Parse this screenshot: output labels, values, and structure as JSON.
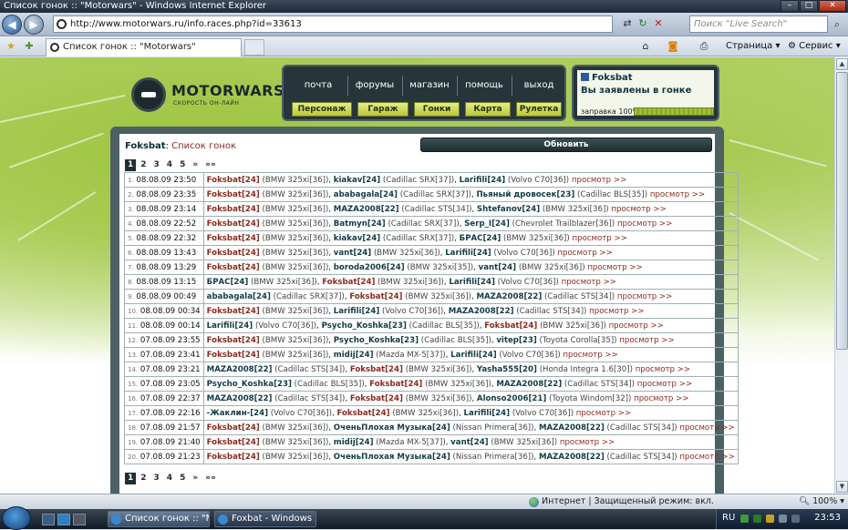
{
  "window": {
    "title": "Список гонок :: \"Motorwars\" - Windows Internet Explorer"
  },
  "browser": {
    "url": "http://www.motorwars.ru/info.races.php?id=33613",
    "search_placeholder": "Поиск \"Live Search\"",
    "tab_title": "Список гонок :: \"Motorwars\"",
    "page_menu": "Страница",
    "tools_menu": "Сервис"
  },
  "site": {
    "logo_text": "MOTORWARS.RU",
    "logo_sub": "СКОРОСТЬ ОН-ЛАЙН",
    "menu_top": [
      "почта",
      "форумы",
      "магазин",
      "помощь",
      "выход"
    ],
    "menu_bottom": [
      "Персонаж",
      "Гараж",
      "Гонки",
      "Карта",
      "Рулетка"
    ],
    "user": {
      "name": "Foksbat",
      "status": "Вы заявлены в гонке",
      "fuel_label": "заправка 100%",
      "fuel_percent": 100
    }
  },
  "races": {
    "user": "Foksbat",
    "title_sep": ":",
    "title": "Список гонок",
    "refresh": "Обновить",
    "pages": [
      "1",
      "2",
      "3",
      "4",
      "5",
      "»",
      "»»"
    ],
    "current_page": "1",
    "view_label": "просмотр >>",
    "rows": [
      {
        "n": "1.",
        "date": "08.08.09 23:50",
        "racers": [
          {
            "name": "Foksbat[24]",
            "car": "(BMW 325xi[36])"
          },
          {
            "name": "kiakav[24]",
            "car": "(Cadillac SRX[37])"
          },
          {
            "name": "Larifili[24]",
            "car": "(Volvo C70[36])"
          }
        ]
      },
      {
        "n": "2.",
        "date": "08.08.09 23:35",
        "racers": [
          {
            "name": "Foksbat[24]",
            "car": "(BMW 325xi[36])"
          },
          {
            "name": "ababagala[24]",
            "car": "(Cadillac SRX[37])"
          },
          {
            "name": "Пьяный дровосек[23]",
            "car": "(Cadillac BLS[35])"
          }
        ]
      },
      {
        "n": "3.",
        "date": "08.08.09 23:14",
        "racers": [
          {
            "name": "Foksbat[24]",
            "car": "(BMW 325xi[36])"
          },
          {
            "name": "MAZA2008[22]",
            "car": "(Cadillac STS[34])"
          },
          {
            "name": "Shtefanov[24]",
            "car": "(BMW 325xi[36])"
          }
        ]
      },
      {
        "n": "4.",
        "date": "08.08.09 22:52",
        "racers": [
          {
            "name": "Foksbat[24]",
            "car": "(BMW 325xi[36])"
          },
          {
            "name": "Batmyn[24]",
            "car": "(Cadillac SRX[37])"
          },
          {
            "name": "Serp_I[24]",
            "car": "(Chevrolet Trailblazer[36])"
          }
        ]
      },
      {
        "n": "5.",
        "date": "08.08.09 22:32",
        "racers": [
          {
            "name": "Foksbat[24]",
            "car": "(BMW 325xi[36])"
          },
          {
            "name": "kiakav[24]",
            "car": "(Cadillac SRX[37])"
          },
          {
            "name": "БРАС[24]",
            "car": "(BMW 325xi[36])"
          }
        ]
      },
      {
        "n": "6.",
        "date": "08.08.09 13:43",
        "racers": [
          {
            "name": "Foksbat[24]",
            "car": "(BMW 325xi[36])"
          },
          {
            "name": "vant[24]",
            "car": "(BMW 325xi[36])"
          },
          {
            "name": "Larifili[24]",
            "car": "(Volvo C70[36])"
          }
        ]
      },
      {
        "n": "7.",
        "date": "08.08.09 13:29",
        "racers": [
          {
            "name": "Foksbat[24]",
            "car": "(BMW 325xi[36])"
          },
          {
            "name": "boroda2006[24]",
            "car": "(BMW 325xi[35])"
          },
          {
            "name": "vant[24]",
            "car": "(BMW 325xi[36])"
          }
        ]
      },
      {
        "n": "8.",
        "date": "08.08.09 13:15",
        "racers": [
          {
            "name": "БРАС[24]",
            "car": "(BMW 325xi[36])"
          },
          {
            "name": "Foksbat[24]",
            "car": "(BMW 325xi[36])"
          },
          {
            "name": "Larifili[24]",
            "car": "(Volvo C70[36])"
          }
        ]
      },
      {
        "n": "9.",
        "date": "08.08.09 00:49",
        "racers": [
          {
            "name": "ababagala[24]",
            "car": "(Cadillac SRX[37])"
          },
          {
            "name": "Foksbat[24]",
            "car": "(BMW 325xi[36])"
          },
          {
            "name": "MAZA2008[22]",
            "car": "(Cadillac STS[34])"
          }
        ]
      },
      {
        "n": "10.",
        "date": "08.08.09 00:34",
        "racers": [
          {
            "name": "Foksbat[24]",
            "car": "(BMW 325xi[36])"
          },
          {
            "name": "Larifili[24]",
            "car": "(Volvo C70[36])"
          },
          {
            "name": "MAZA2008[22]",
            "car": "(Cadillac STS[34])"
          }
        ]
      },
      {
        "n": "11.",
        "date": "08.08.09 00:14",
        "racers": [
          {
            "name": "Larifili[24]",
            "car": "(Volvo C70[36])"
          },
          {
            "name": "Psycho_Koshka[23]",
            "car": "(Cadillac BLS[35])"
          },
          {
            "name": "Foksbat[24]",
            "car": "(BMW 325xi[36])"
          }
        ]
      },
      {
        "n": "12.",
        "date": "07.08.09 23:55",
        "racers": [
          {
            "name": "Foksbat[24]",
            "car": "(BMW 325xi[36])"
          },
          {
            "name": "Psycho_Koshka[23]",
            "car": "(Cadillac BLS[35])"
          },
          {
            "name": "vitep[23]",
            "car": "(Toyota Corolla[35])"
          }
        ]
      },
      {
        "n": "13.",
        "date": "07.08.09 23:41",
        "racers": [
          {
            "name": "Foksbat[24]",
            "car": "(BMW 325xi[36])"
          },
          {
            "name": "midij[24]",
            "car": "(Mazda MX-5[37])"
          },
          {
            "name": "Larifili[24]",
            "car": "(Volvo C70[36])"
          }
        ]
      },
      {
        "n": "14.",
        "date": "07.08.09 23:21",
        "racers": [
          {
            "name": "MAZA2008[22]",
            "car": "(Cadillac STS[34])"
          },
          {
            "name": "Foksbat[24]",
            "car": "(BMW 325xi[36])"
          },
          {
            "name": "Yasha555[20]",
            "car": "(Honda Integra 1.6[30])"
          }
        ]
      },
      {
        "n": "15.",
        "date": "07.08.09 23:05",
        "racers": [
          {
            "name": "Psycho_Koshka[23]",
            "car": "(Cadillac BLS[35])"
          },
          {
            "name": "Foksbat[24]",
            "car": "(BMW 325xi[36])"
          },
          {
            "name": "MAZA2008[22]",
            "car": "(Cadillac STS[34])"
          }
        ]
      },
      {
        "n": "16.",
        "date": "07.08.09 22:37",
        "racers": [
          {
            "name": "MAZA2008[22]",
            "car": "(Cadillac STS[34])"
          },
          {
            "name": "Foksbat[24]",
            "car": "(BMW 325xi[36])"
          },
          {
            "name": "Alonso2006[21]",
            "car": "(Toyota Windom[32])"
          }
        ]
      },
      {
        "n": "17.",
        "date": "07.08.09 22:16",
        "racers": [
          {
            "name": "-Жаклин-[24]",
            "car": "(Volvo C70[36])"
          },
          {
            "name": "Foksbat[24]",
            "car": "(BMW 325xi[36])"
          },
          {
            "name": "Larifili[24]",
            "car": "(Volvo C70[36])"
          }
        ]
      },
      {
        "n": "18.",
        "date": "07.08.09 21:57",
        "racers": [
          {
            "name": "Foksbat[24]",
            "car": "(BMW 325xi[36])"
          },
          {
            "name": "ОченьПлохая Музыка[24]",
            "car": "(Nissan Primera[36])"
          },
          {
            "name": "MAZA2008[22]",
            "car": "(Cadillac STS[34])"
          }
        ]
      },
      {
        "n": "19.",
        "date": "07.08.09 21:40",
        "racers": [
          {
            "name": "Foksbat[24]",
            "car": "(BMW 325xi[36])"
          },
          {
            "name": "midij[24]",
            "car": "(Mazda MX-5[37])"
          },
          {
            "name": "vant[24]",
            "car": "(BMW 325xi[36])"
          }
        ]
      },
      {
        "n": "20.",
        "date": "07.08.09 21:23",
        "racers": [
          {
            "name": "Foksbat[24]",
            "car": "(BMW 325xi[36])"
          },
          {
            "name": "ОченьПлохая Музыка[24]",
            "car": "(Nissan Primera[36])"
          },
          {
            "name": "MAZA2008[22]",
            "car": "(Cadillac STS[34])"
          }
        ]
      }
    ]
  },
  "statusbar": {
    "zone": "Интернет | Защищенный режим: вкл.",
    "zoom": "100%"
  },
  "taskbar": {
    "tasks": [
      "Список гонок :: \"M...",
      "Foxbat - Windows I..."
    ],
    "lang": "RU",
    "clock": "23:53"
  }
}
